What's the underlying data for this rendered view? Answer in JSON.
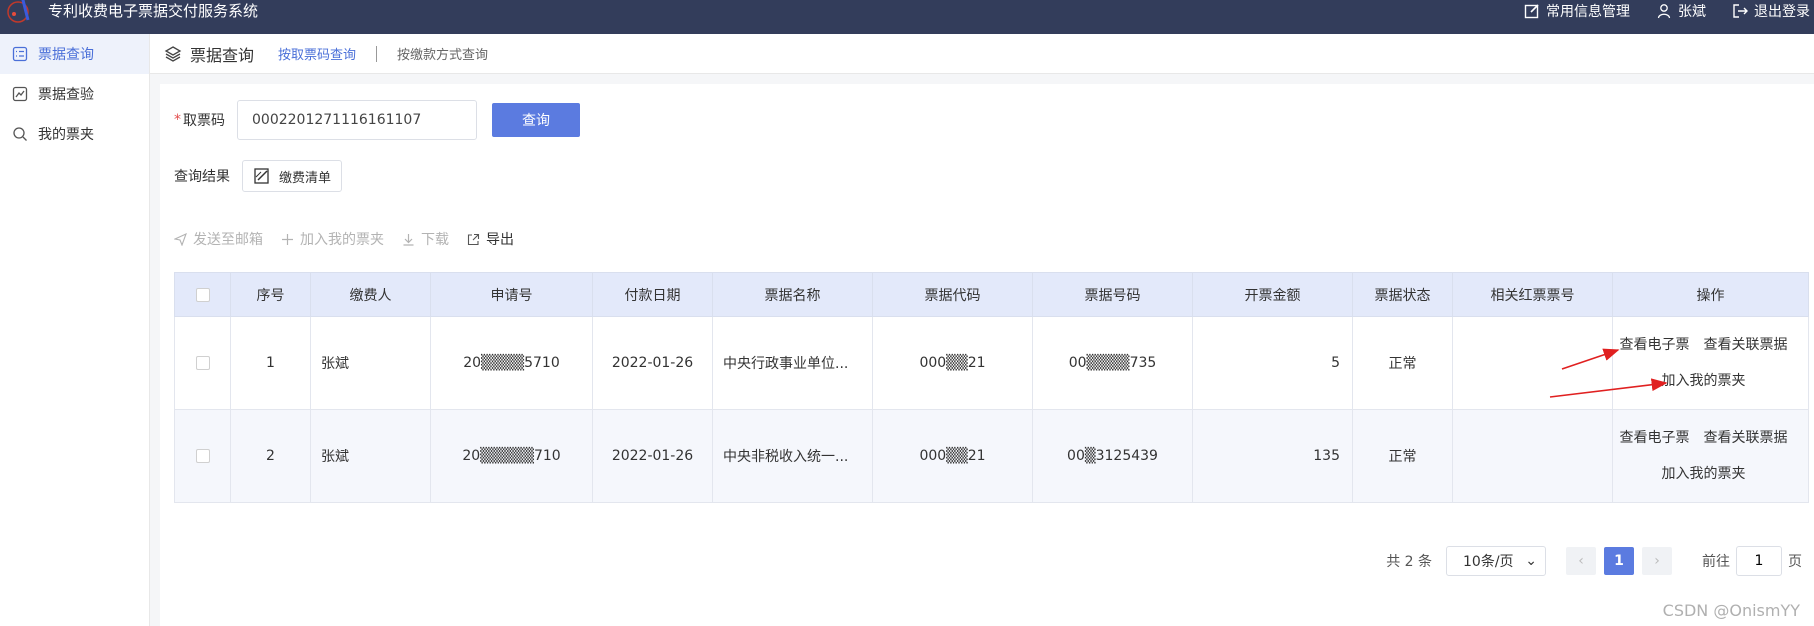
{
  "app": {
    "title": "专利收费电子票据交付服务系统"
  },
  "topbar": {
    "info_mgmt": "常用信息管理",
    "user": "张斌",
    "logout": "退出登录"
  },
  "sidebar": {
    "items": [
      {
        "label": "票据查询"
      },
      {
        "label": "票据查验"
      },
      {
        "label": "我的票夹"
      }
    ]
  },
  "subheader": {
    "title": "票据查询",
    "tab_active": "按取票码查询",
    "tab_other": "按缴款方式查询"
  },
  "form": {
    "required_mark": "*",
    "label": "取票码",
    "value": "0002201271116161107",
    "query_button": "查询"
  },
  "result": {
    "label": "查询结果",
    "fee_list_button": "缴费清单"
  },
  "toolbar": {
    "send_mail": "发送至邮箱",
    "add_folder": "加入我的票夹",
    "download": "下载",
    "export": "导出"
  },
  "table": {
    "headers": [
      "序号",
      "缴费人",
      "申请号",
      "付款日期",
      "票据名称",
      "票据代码",
      "票据号码",
      "开票金额",
      "票据状态",
      "相关红票票号",
      "操作"
    ],
    "rows": [
      {
        "no": "1",
        "payer": "张斌",
        "app_no": "20▒▒▒▒5710",
        "date": "2022-01-26",
        "name": "中央行政事业单位...",
        "code": "000▒▒21",
        "number": "00▒▒▒▒735",
        "amount": "5",
        "status": "正常",
        "red": ""
      },
      {
        "no": "2",
        "payer": "张斌",
        "app_no": "20▒▒▒▒▒710",
        "date": "2022-01-26",
        "name": "中央非税收入统一...",
        "code": "000▒▒21",
        "number": "00▒3125439",
        "amount": "135",
        "status": "正常",
        "red": ""
      }
    ],
    "ops": {
      "view": "查看电子票",
      "related": "查看关联票据",
      "add": "加入我的票夹"
    }
  },
  "pager": {
    "total": "共 2 条",
    "size": "10条/页",
    "page": "1",
    "goto": "前往",
    "goto_value": "1",
    "page_unit": "页"
  },
  "watermark": "CSDN @OnismYY",
  "colors": {
    "topbar": "#333d5b",
    "accent": "#5b7be0",
    "arrow": "#e02020"
  }
}
